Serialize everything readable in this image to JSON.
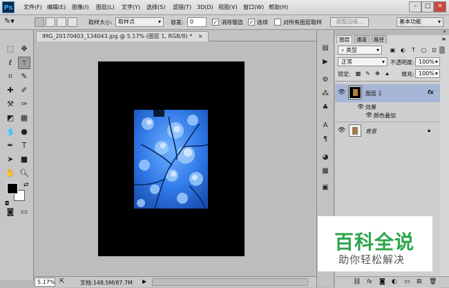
{
  "app": {
    "logo": "Ps",
    "brand_color": "#0a2a4a",
    "accent": "#33a6ff"
  },
  "menu": [
    "文件(F)",
    "编辑(E)",
    "图像(I)",
    "图层(L)",
    "文字(Y)",
    "选择(S)",
    "滤镜(T)",
    "3D(D)",
    "视图(V)",
    "窗口(W)",
    "帮助(H)"
  ],
  "window_controls": {
    "minimize": "–",
    "maximize": "□",
    "close": "×"
  },
  "options": {
    "sample_size_label": "取样大小:",
    "sample_size_value": "取样点",
    "tolerance_label": "容差:",
    "tolerance_value": "0",
    "antialias_label": "消除锯齿",
    "contiguous_label": "连续",
    "all_layers_label": "对所有图层取样",
    "refine_edge_label": "调整边缘...",
    "workspace_value": "基本功能"
  },
  "document": {
    "tab_title": "IMG_20170403_134043.jpg @ 5.17% (图层 1, RGB/8) *",
    "tab_close": "×"
  },
  "status": {
    "zoom": "5.17%",
    "doc_info": "文档:148.5M/87.7M"
  },
  "panel": {
    "tabs": [
      "图层",
      "通道",
      "路径"
    ],
    "filter_kind": "类型",
    "blend_mode": "正常",
    "opacity_label": "不透明度:",
    "opacity_value": "100%",
    "lock_label": "锁定:",
    "fill_label": "填充:",
    "fill_value": "100%",
    "layers": [
      {
        "name": "图层 1",
        "fx": "fx",
        "effects_label": "效果",
        "effect": "颜色叠加"
      },
      {
        "name": "背景"
      }
    ]
  },
  "watermark": {
    "title": "百科全说",
    "subtitle": "助你轻松解决",
    "color": "#2aa54a"
  }
}
